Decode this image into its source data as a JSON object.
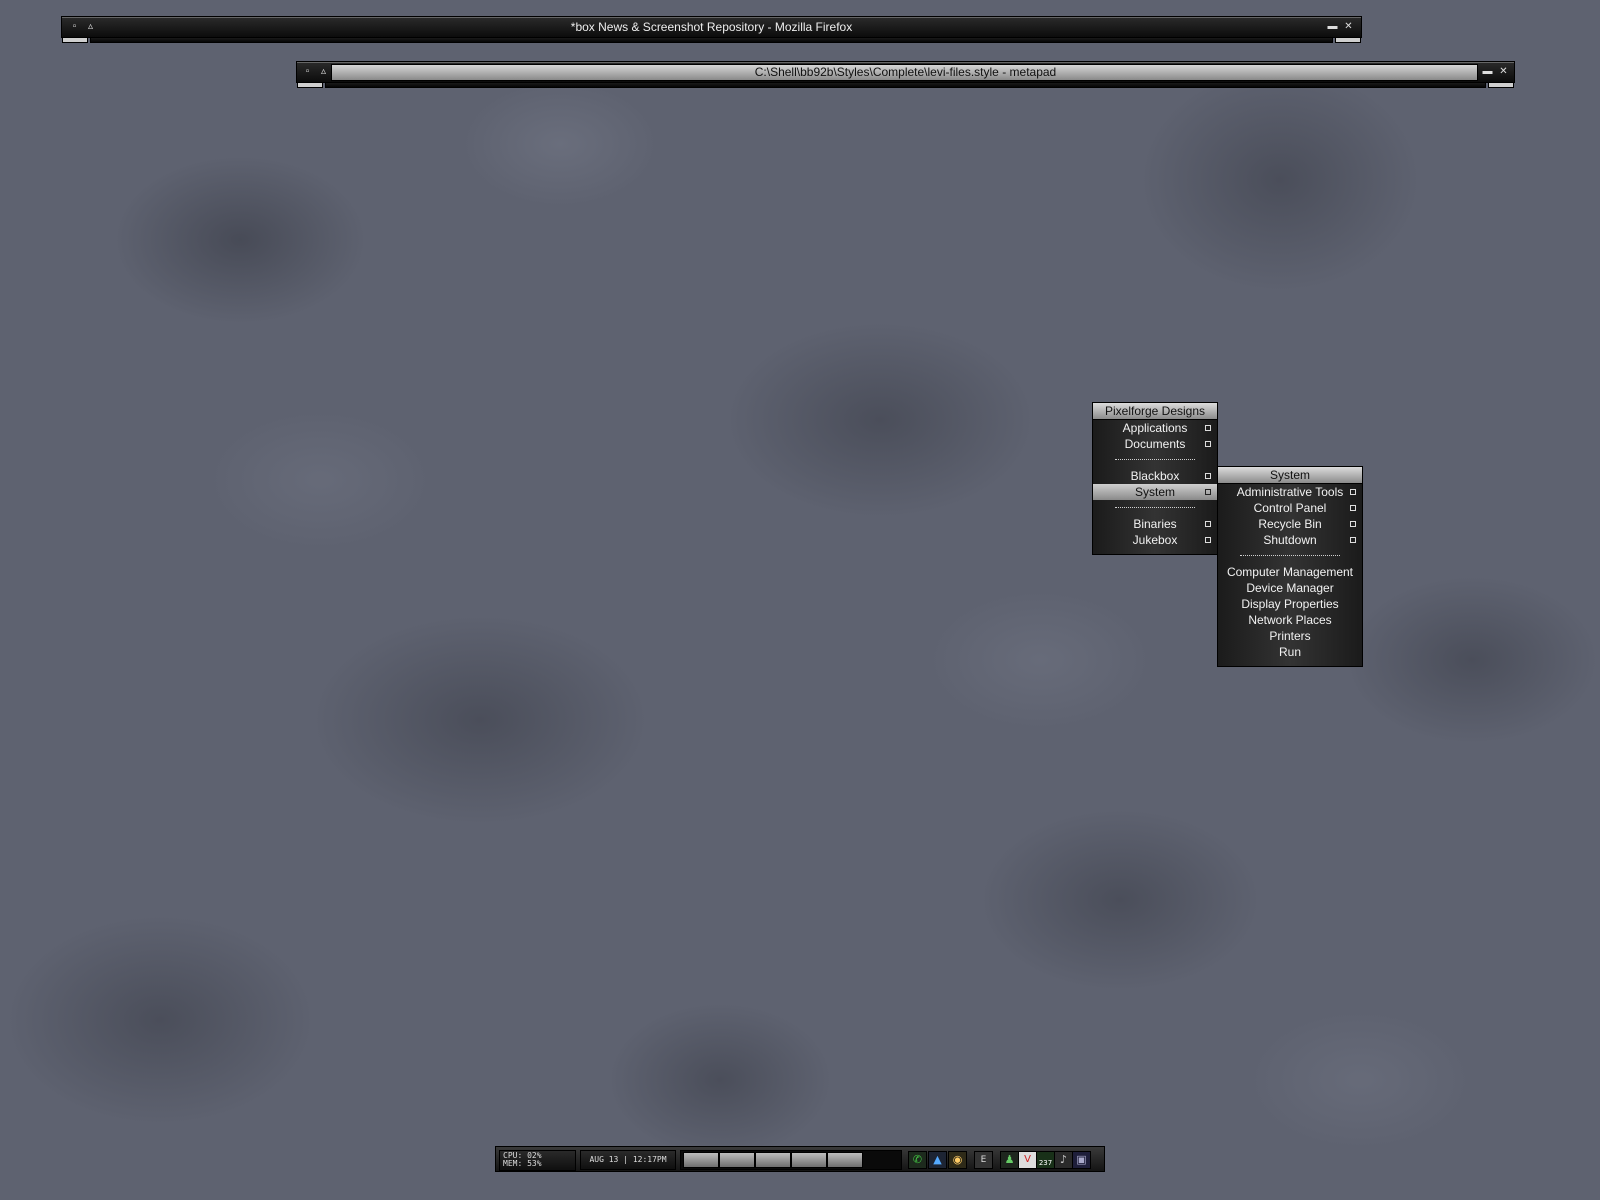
{
  "windows": [
    {
      "title": "*box News & Screenshot Repository - Mozilla Firefox"
    },
    {
      "title": "C:\\Shell\\bb92b\\Styles\\Complete\\levi-files.style - metapad"
    }
  ],
  "root_menu": {
    "title": "Pixelforge Designs",
    "items": [
      {
        "label": "Applications"
      },
      {
        "label": "Documents"
      },
      {
        "label": "Blackbox"
      },
      {
        "label": "System"
      },
      {
        "label": "Binaries"
      },
      {
        "label": "Jukebox"
      }
    ]
  },
  "system_menu": {
    "title": "System",
    "items": [
      {
        "label": "Administrative Tools"
      },
      {
        "label": "Control Panel"
      },
      {
        "label": "Recycle Bin"
      },
      {
        "label": "Shutdown"
      },
      {
        "label": "Computer Management"
      },
      {
        "label": "Device Manager"
      },
      {
        "label": "Display Properties"
      },
      {
        "label": "Network Places"
      },
      {
        "label": "Printers"
      },
      {
        "label": "Run"
      }
    ]
  },
  "taskbar": {
    "cpu_label": "CPU:",
    "cpu_value": "02%",
    "mem_label": "MEM:",
    "mem_value": "53%",
    "clock": "AUG 13 | 12:17PM",
    "tray_badge": "237",
    "tray_icons": [
      "phone-icon",
      "chart-icon",
      "palette-icon",
      "e-icon",
      "network-icon",
      "shield-icon",
      "monitor-icon",
      "speaker-icon",
      "window-icon"
    ]
  }
}
